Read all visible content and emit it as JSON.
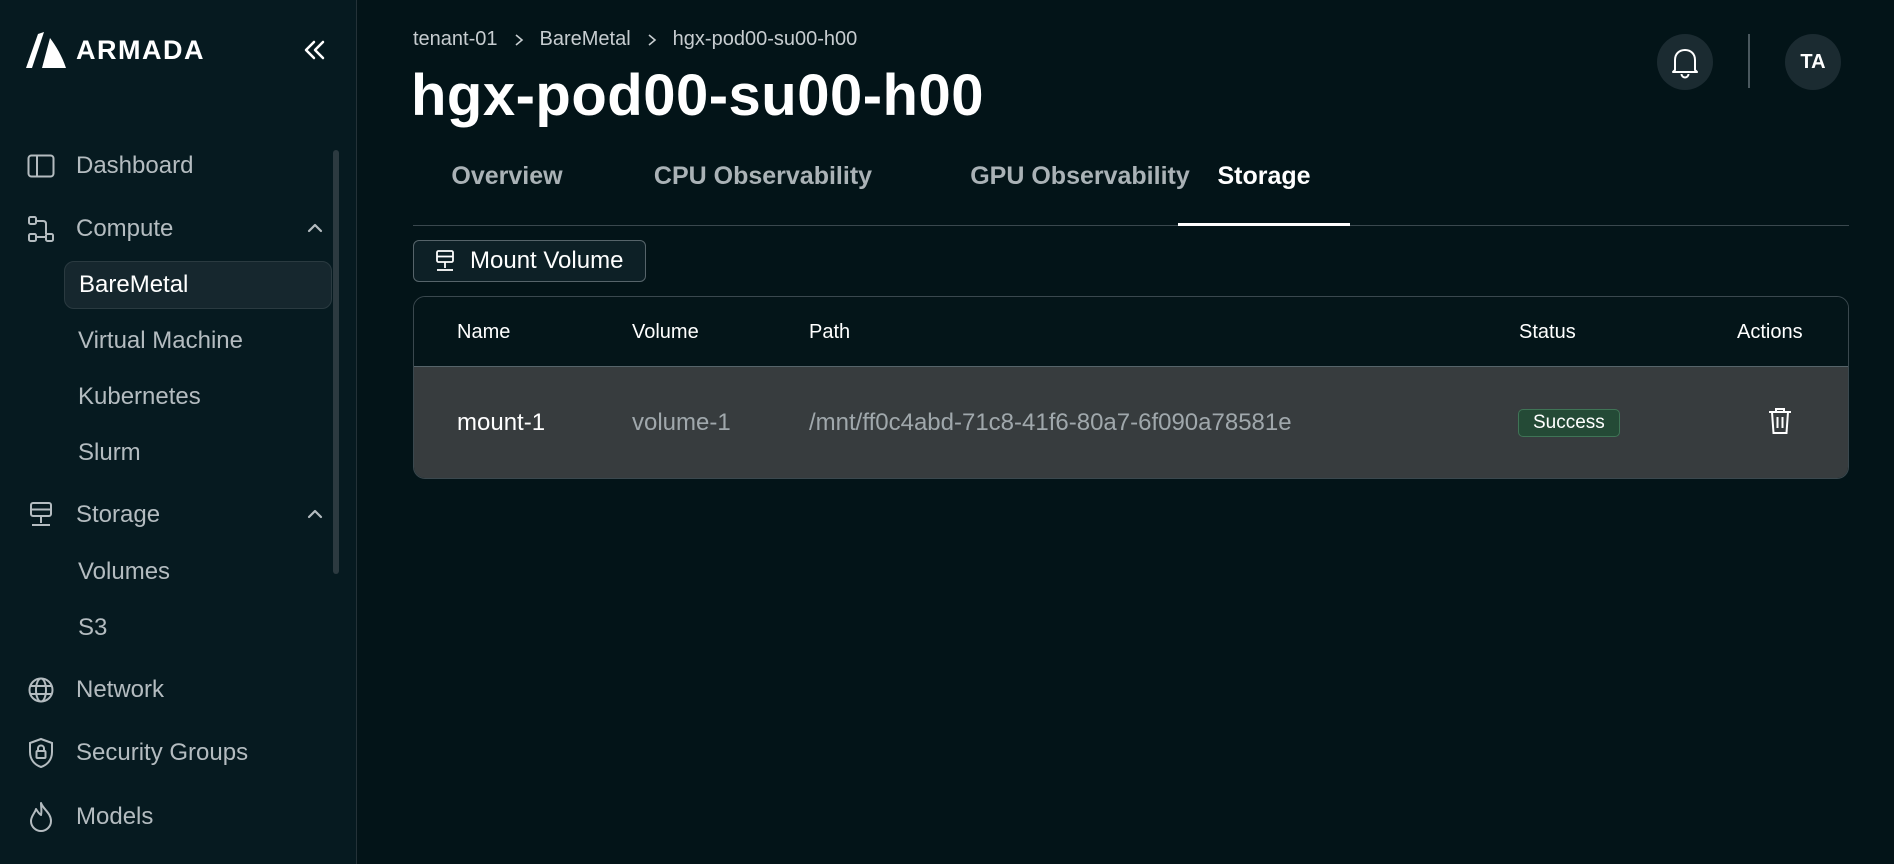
{
  "brand": {
    "name": "ARMADA"
  },
  "sidebar": {
    "items": [
      {
        "label": "Dashboard",
        "icon": "sidebar-panel-icon"
      },
      {
        "label": "Compute",
        "icon": "compute-nodes-icon",
        "expanded": true,
        "children": [
          "BareMetal",
          "Virtual Machine",
          "Kubernetes",
          "Slurm"
        ]
      },
      {
        "label": "Storage",
        "icon": "server-icon",
        "expanded": true,
        "children": [
          "Volumes",
          "S3"
        ]
      },
      {
        "label": "Network",
        "icon": "globe-icon"
      },
      {
        "label": "Security Groups",
        "icon": "shield-lock-icon"
      },
      {
        "label": "Models",
        "icon": "flame-icon"
      }
    ],
    "active_child": "BareMetal"
  },
  "breadcrumb": [
    "tenant-01",
    "BareMetal",
    "hgx-pod00-su00-h00"
  ],
  "page": {
    "title": "hgx-pod00-su00-h00"
  },
  "header": {
    "avatar_initials": "TA"
  },
  "tabs": [
    {
      "label": "Overview",
      "active": false
    },
    {
      "label": "CPU Observability",
      "active": false
    },
    {
      "label": "GPU Observability",
      "active": false
    },
    {
      "label": "Storage",
      "active": true
    }
  ],
  "actions": {
    "mount_label": "Mount Volume"
  },
  "table": {
    "columns": [
      "Name",
      "Volume",
      "Path",
      "Status",
      "Actions"
    ],
    "rows": [
      {
        "name": "mount-1",
        "volume": "volume-1",
        "path": "/mnt/ff0c4abd-71c8-41f6-80a7-6f090a78581e",
        "status": "Success"
      }
    ]
  },
  "colors": {
    "background": "#031418",
    "success": "#244a36"
  }
}
